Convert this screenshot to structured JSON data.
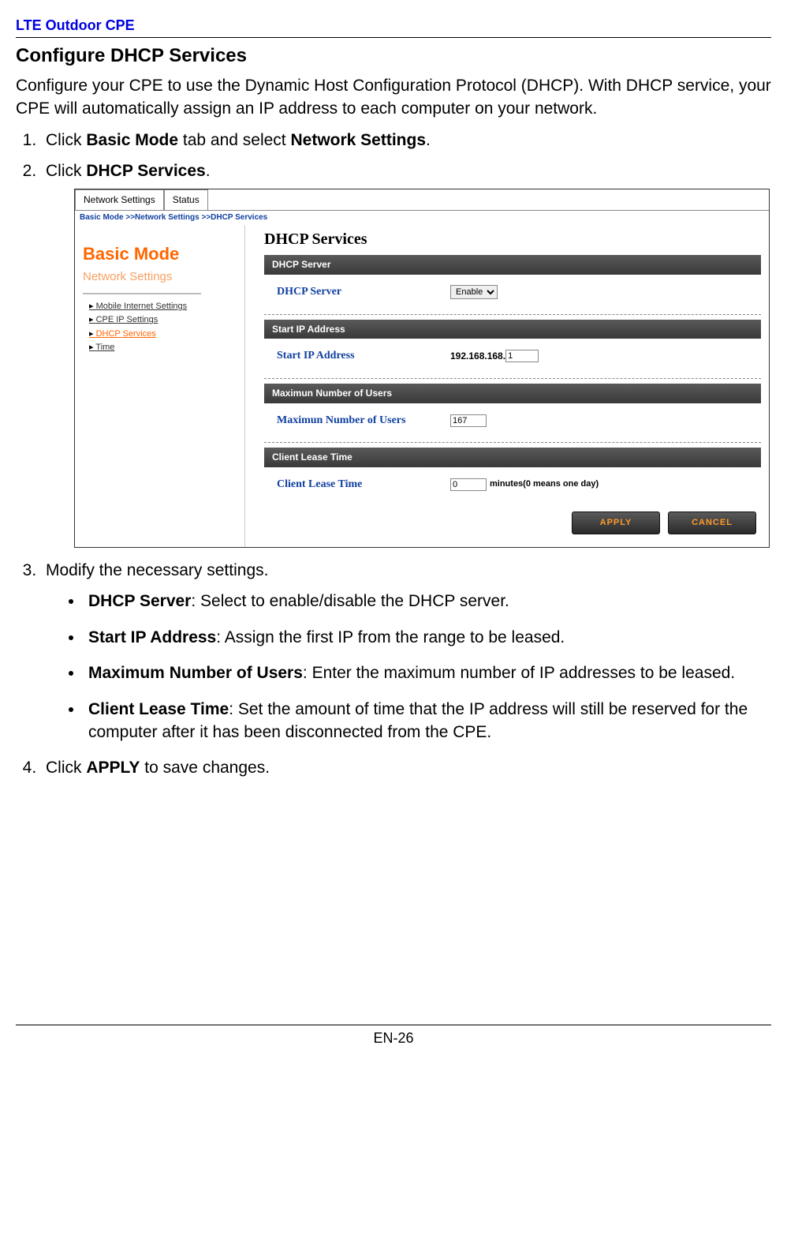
{
  "doc_header": "LTE Outdoor CPE",
  "section_title": "Configure DHCP Services",
  "intro": "Configure your CPE to use the Dynamic Host Configuration Protocol (DHCP). With DHCP service, your CPE will automatically assign an IP address to each computer on your network.",
  "step1_pre": "Click ",
  "step1_b1": "Basic Mode",
  "step1_mid": " tab and select ",
  "step1_b2": "Network Settings",
  "step1_end": ".",
  "step2_pre": "Click ",
  "step2_b": "DHCP Services",
  "step2_end": ".",
  "step3": "Modify the necessary settings.",
  "bullet1_b": "DHCP Server",
  "bullet1_t": ": Select to enable/disable the DHCP server.",
  "bullet2_b": "Start IP Address",
  "bullet2_t": ": Assign the first IP from the range to be leased.",
  "bullet3_b": "Maximum Number of Users",
  "bullet3_t": ": Enter the maximum number of IP addresses to be leased.",
  "bullet4_b": "Client Lease Time",
  "bullet4_t": ": Set the amount of time that the IP address will still be reserved for the computer after it has been disconnected from the CPE.",
  "step4_pre": "Click ",
  "step4_b": "APPLY",
  "step4_end": " to save changes.",
  "page_number": "EN-26",
  "screenshot": {
    "tabs": {
      "t1": "Network Settings",
      "t2": "Status"
    },
    "breadcrumb": "Basic Mode >>Network Settings >>DHCP Services",
    "mode_title": "Basic Mode",
    "mode_subtitle": "Network Settings",
    "menu": {
      "m1": "Mobile Internet Settings",
      "m2": "CPE IP Settings",
      "m3": "DHCP Services",
      "m4": "Time"
    },
    "page_title": "DHCP Services",
    "sec1": {
      "header": "DHCP Server",
      "label": "DHCP Server",
      "value": "Enable"
    },
    "sec2": {
      "header": "Start IP Address",
      "label": "Start IP Address",
      "prefix": "192.168.168.",
      "value": "1"
    },
    "sec3": {
      "header": "Maximun Number of Users",
      "label": "Maximun Number of Users",
      "value": "167"
    },
    "sec4": {
      "header": "Client Lease Time",
      "label": "Client Lease Time",
      "value": "0",
      "hint": "minutes(0 means one day)"
    },
    "btn_apply": "APPLY",
    "btn_cancel": "CANCEL"
  }
}
